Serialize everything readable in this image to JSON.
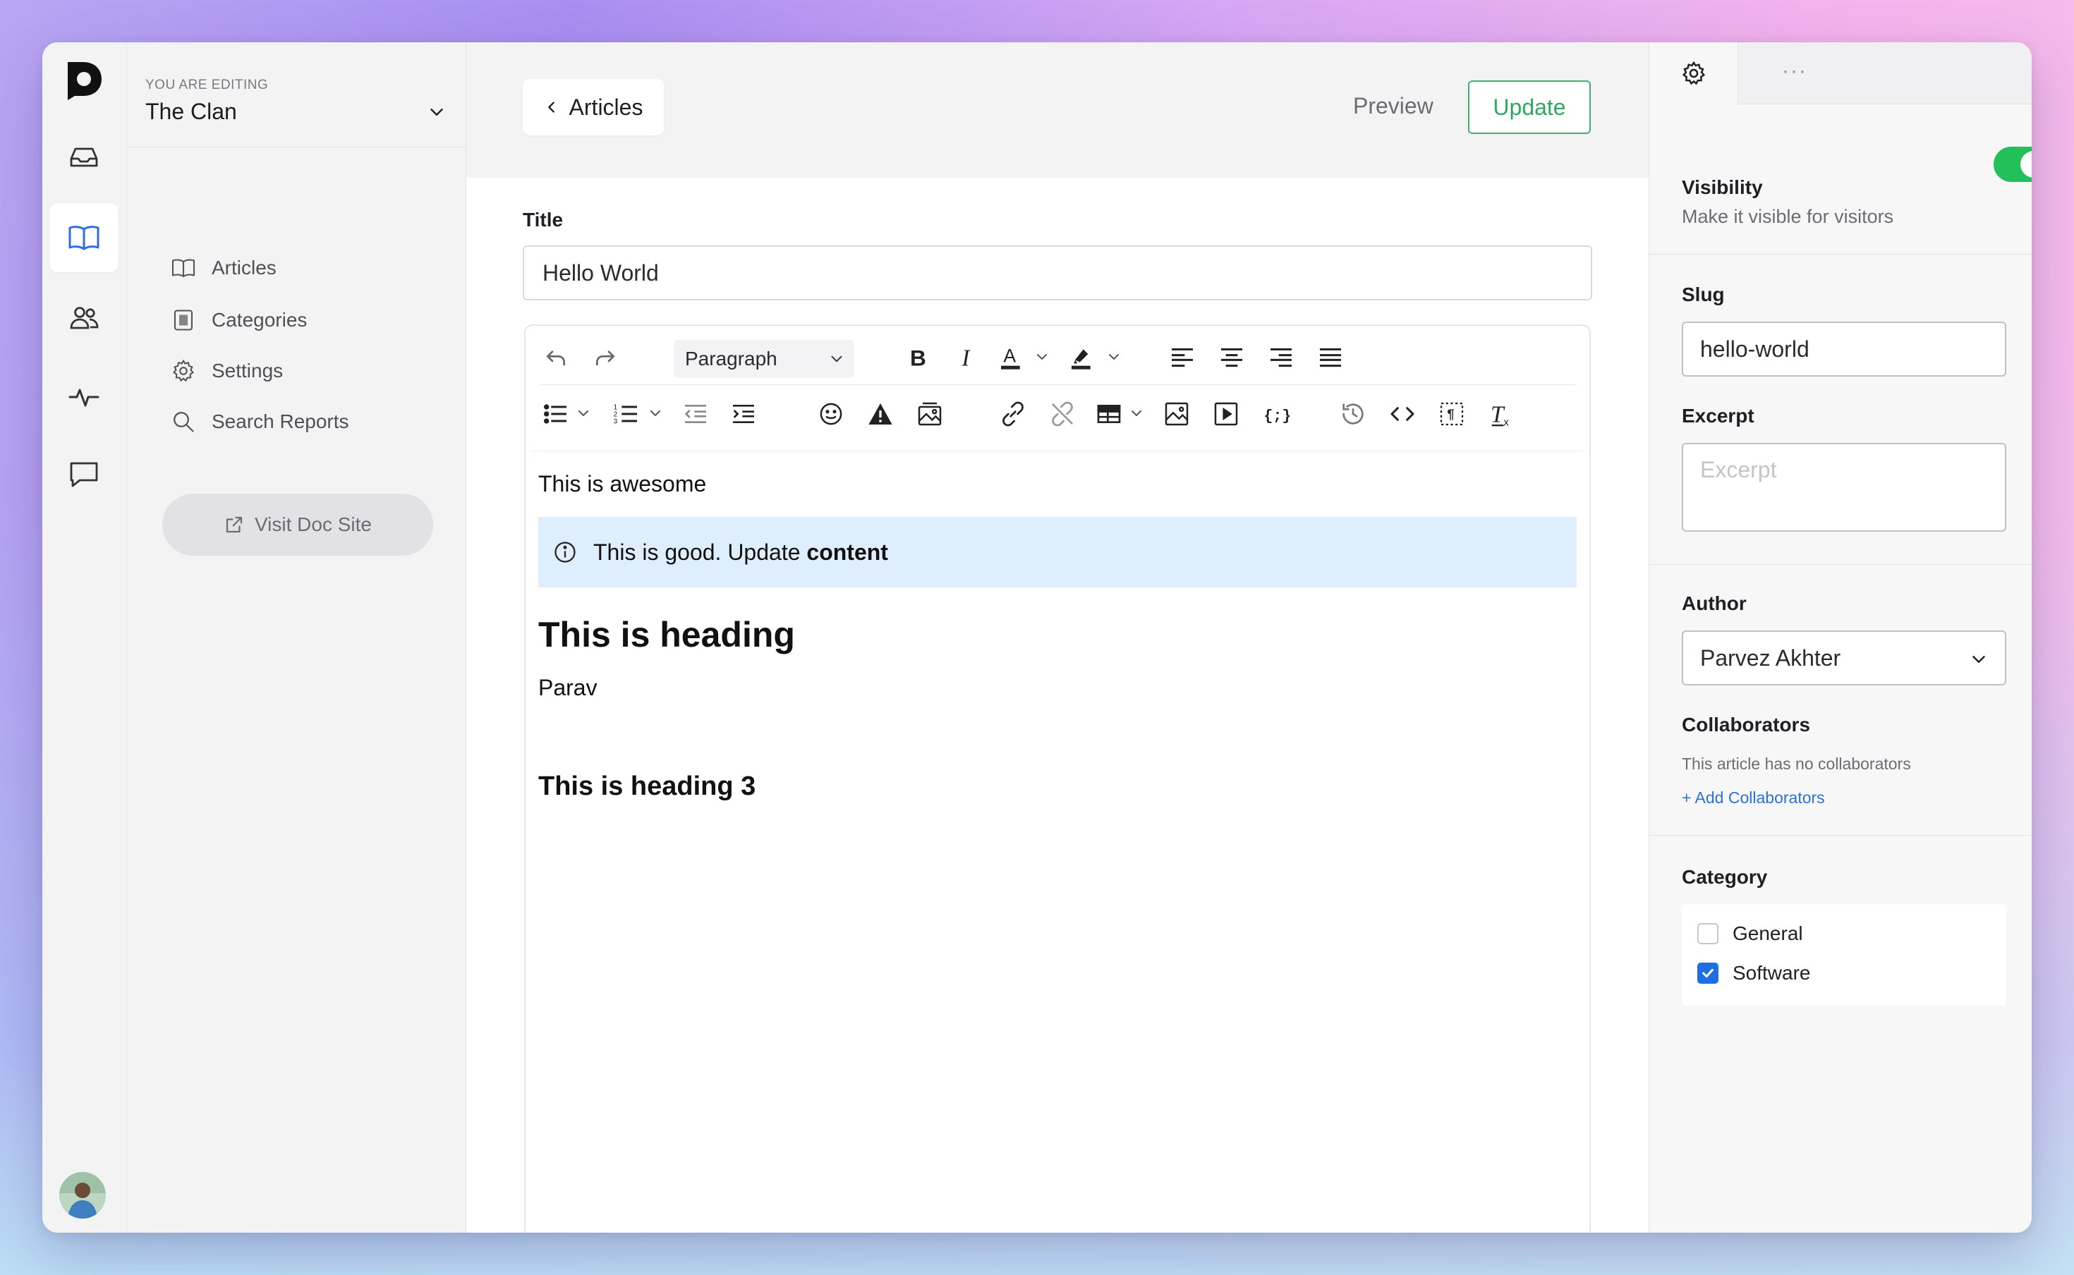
{
  "sidenav": {
    "editing_label": "YOU ARE EDITING",
    "workspace": "The Clan",
    "items": [
      {
        "label": "Articles",
        "icon": "book-icon"
      },
      {
        "label": "Categories",
        "icon": "categories-icon"
      },
      {
        "label": "Settings",
        "icon": "gear-icon"
      },
      {
        "label": "Search Reports",
        "icon": "search-icon"
      }
    ],
    "visit_label": "Visit Doc Site"
  },
  "rail": {
    "items": [
      "inbox-icon",
      "book-icon",
      "users-icon",
      "activity-icon",
      "chat-icon"
    ],
    "active": "book-icon"
  },
  "topbar": {
    "back_label": "Articles",
    "preview_label": "Preview",
    "update_label": "Update"
  },
  "form": {
    "title_label": "Title",
    "title_value": "Hello World"
  },
  "toolbar": {
    "block_format": "Paragraph"
  },
  "content": {
    "p1": "This is awesome",
    "callout_prefix": "This is good. Update ",
    "callout_bold": "content",
    "h1": "This is heading",
    "p2": "Parav",
    "h3": "This is heading 3"
  },
  "settings": {
    "visibility_label": "Visibility",
    "visibility_sub": "Make it visible for visitors",
    "visibility_on": true,
    "slug_label": "Slug",
    "slug_value": "hello-world",
    "excerpt_label": "Excerpt",
    "excerpt_placeholder": "Excerpt",
    "author_label": "Author",
    "author_value": "Parvez Akhter",
    "collab_label": "Collaborators",
    "collab_empty": "This article has no collaborators",
    "collab_add": "+ Add Collaborators",
    "category_label": "Category",
    "categories": [
      {
        "label": "General",
        "checked": false
      },
      {
        "label": "Software",
        "checked": true
      }
    ]
  },
  "colors": {
    "accent_green": "#2ea863",
    "toggle_on": "#23c05a",
    "callout_bg": "#deeefc",
    "checkbox_blue": "#1f6fe0",
    "link_blue": "#2b72d8"
  }
}
